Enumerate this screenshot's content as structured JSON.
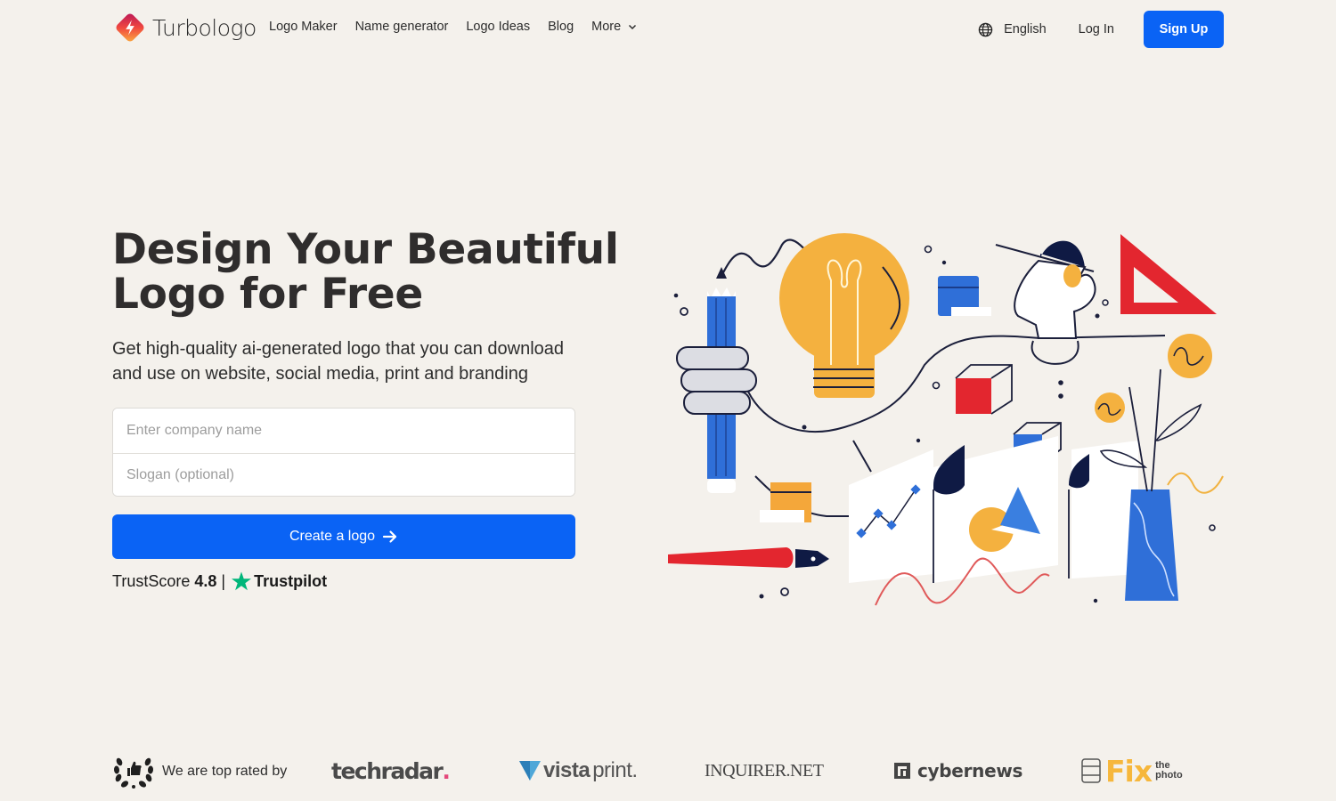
{
  "brand": {
    "name": "Turbologo"
  },
  "nav": {
    "links": [
      {
        "label": "Logo Maker"
      },
      {
        "label": "Name generator"
      },
      {
        "label": "Logo Ideas"
      },
      {
        "label": "Blog"
      },
      {
        "label": "More"
      }
    ],
    "language": "English",
    "login": "Log In",
    "signup": "Sign Up"
  },
  "hero": {
    "title": "Design Your Beautiful Logo for Free",
    "subtitle": "Get high-quality ai-generated logo that you can download and use on website, social media, print and branding",
    "company_placeholder": "Enter company name",
    "company_value": "",
    "slogan_placeholder": "Slogan (optional)",
    "slogan_value": "",
    "create_button": "Create a logo",
    "trust": {
      "label": "TrustScore",
      "score": "4.8",
      "separator": "|",
      "provider": "Trustpilot"
    }
  },
  "rated": {
    "label": "We are top rated by",
    "press": [
      {
        "name": "techradar",
        "suffix": "."
      },
      {
        "name": "vistaprint",
        "bold": "vista",
        "light": "print."
      },
      {
        "name": "INQUIRER.NET"
      },
      {
        "name": "cybernews"
      },
      {
        "name": "Fix the photo",
        "word": "Fix",
        "sub1": "the",
        "sub2": "photo"
      }
    ]
  },
  "colors": {
    "background": "#f4f1ec",
    "primary": "#0a63f5",
    "trustpilot_green": "#00b67a",
    "text": "#2f2d2d"
  },
  "icons": {
    "language": "globe-icon",
    "more": "chevron-down-icon",
    "create": "arrow-right-icon",
    "trust": "star-icon",
    "rated": "laurel-thumbs-up-icon"
  }
}
